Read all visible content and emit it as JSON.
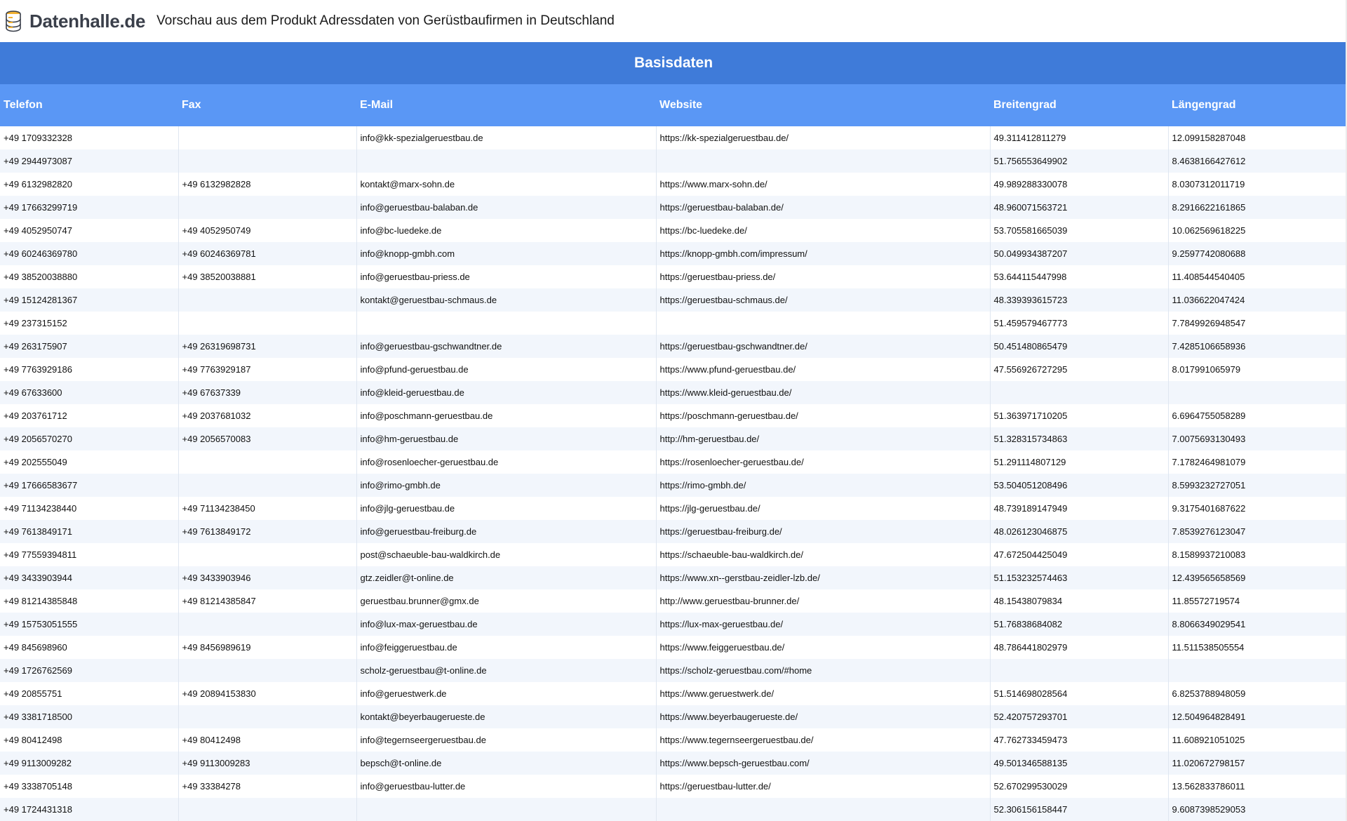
{
  "header": {
    "logo_text": "Datenhalle.de",
    "title": "Vorschau aus dem Produkt Adressdaten von Gerüstbaufirmen in Deutschland"
  },
  "colors": {
    "group_header": "#3f7bd9",
    "column_header": "#5a97f5",
    "row_alt": "#f2f6fc"
  },
  "table": {
    "group_label": "Basisdaten",
    "columns": [
      "Telefon",
      "Fax",
      "E-Mail",
      "Website",
      "Breitengrad",
      "Längengrad"
    ],
    "rows": [
      [
        "+49 1709332328",
        "",
        "info@kk-spezialgeruestbau.de",
        "https://kk-spezialgeruestbau.de/",
        "49.311412811279",
        "12.099158287048"
      ],
      [
        "+49 2944973087",
        "",
        "",
        "",
        "51.756553649902",
        "8.4638166427612"
      ],
      [
        "+49 6132982820",
        "+49 6132982828",
        "kontakt@marx-sohn.de",
        "https://www.marx-sohn.de/",
        "49.989288330078",
        "8.0307312011719"
      ],
      [
        "+49 17663299719",
        "",
        "info@geruestbau-balaban.de",
        "https://geruestbau-balaban.de/",
        "48.960071563721",
        "8.2916622161865"
      ],
      [
        "+49 4052950747",
        "+49 4052950749",
        "info@bc-luedeke.de",
        "https://bc-luedeke.de/",
        "53.705581665039",
        "10.062569618225"
      ],
      [
        "+49 60246369780",
        "+49 60246369781",
        "info@knopp-gmbh.com",
        "https://knopp-gmbh.com/impressum/",
        "50.049934387207",
        "9.2597742080688"
      ],
      [
        "+49 38520038880",
        "+49 38520038881",
        "info@geruestbau-priess.de",
        "https://geruestbau-priess.de/",
        "53.644115447998",
        "11.408544540405"
      ],
      [
        "+49 15124281367",
        "",
        "kontakt@geruestbau-schmaus.de",
        "https://geruestbau-schmaus.de/",
        "48.339393615723",
        "11.036622047424"
      ],
      [
        "+49 237315152",
        "",
        "",
        "",
        "51.459579467773",
        "7.7849926948547"
      ],
      [
        "+49 263175907",
        "+49 26319698731",
        "info@geruestbau-gschwandtner.de",
        "https://geruestbau-gschwandtner.de/",
        "50.451480865479",
        "7.4285106658936"
      ],
      [
        "+49 7763929186",
        "+49 7763929187",
        "info@pfund-geruestbau.de",
        "https://www.pfund-geruestbau.de/",
        "47.556926727295",
        "8.017991065979"
      ],
      [
        "+49 67633600",
        "+49 67637339",
        "info@kleid-geruestbau.de",
        "https://www.kleid-geruestbau.de/",
        "",
        ""
      ],
      [
        "+49 203761712",
        "+49 2037681032",
        "info@poschmann-geruestbau.de",
        "https://poschmann-geruestbau.de/",
        "51.363971710205",
        "6.6964755058289"
      ],
      [
        "+49 2056570270",
        "+49 2056570083",
        "info@hm-geruestbau.de",
        "http://hm-geruestbau.de/",
        "51.328315734863",
        "7.0075693130493"
      ],
      [
        "+49 202555049",
        "",
        "info@rosenloecher-geruestbau.de",
        "https://rosenloecher-geruestbau.de/",
        "51.291114807129",
        "7.1782464981079"
      ],
      [
        "+49 17666583677",
        "",
        "info@rimo-gmbh.de",
        "https://rimo-gmbh.de/",
        "53.504051208496",
        "8.5993232727051"
      ],
      [
        "+49 71134238440",
        "+49 71134238450",
        "info@jlg-geruestbau.de",
        "https://jlg-geruestbau.de/",
        "48.739189147949",
        "9.3175401687622"
      ],
      [
        "+49 7613849171",
        "+49 7613849172",
        "info@geruestbau-freiburg.de",
        "https://geruestbau-freiburg.de/",
        "48.026123046875",
        "7.8539276123047"
      ],
      [
        "+49 77559394811",
        "",
        "post@schaeuble-bau-waldkirch.de",
        "https://schaeuble-bau-waldkirch.de/",
        "47.672504425049",
        "8.1589937210083"
      ],
      [
        "+49 3433903944",
        "+49 3433903946",
        "gtz.zeidler@t-online.de",
        "https://www.xn--gerstbau-zeidler-lzb.de/",
        "51.153232574463",
        "12.439565658569"
      ],
      [
        "+49 81214385848",
        "+49 81214385847",
        "geruestbau.brunner@gmx.de",
        "http://www.geruestbau-brunner.de/",
        "48.15438079834",
        "11.85572719574"
      ],
      [
        "+49 15753051555",
        "",
        "info@lux-max-geruestbau.de",
        "https://lux-max-geruestbau.de/",
        "51.76838684082",
        "8.8066349029541"
      ],
      [
        "+49 845698960",
        "+49 8456989619",
        "info@feiggeruestbau.de",
        "https://www.feiggeruestbau.de/",
        "48.786441802979",
        "11.511538505554"
      ],
      [
        "+49 1726762569",
        "",
        "scholz-geruestbau@t-online.de",
        "https://scholz-geruestbau.com/#home",
        "",
        ""
      ],
      [
        "+49 20855751",
        "+49 20894153830",
        "info@geruestwerk.de",
        "https://www.geruestwerk.de/",
        "51.514698028564",
        "6.8253788948059"
      ],
      [
        "+49 3381718500",
        "",
        "kontakt@beyerbaugerueste.de",
        "https://www.beyerbaugerueste.de/",
        "52.420757293701",
        "12.504964828491"
      ],
      [
        "+49 80412498",
        "+49 80412498",
        "info@tegernseergeruestbau.de",
        "https://www.tegernseergeruestbau.de/",
        "47.762733459473",
        "11.608921051025"
      ],
      [
        "+49 9113009282",
        "+49 9113009283",
        "bepsch@t-online.de",
        "https://www.bepsch-geruestbau.com/",
        "49.501346588135",
        "11.020672798157"
      ],
      [
        "+49 3338705148",
        "+49 33384278",
        "info@geruestbau-lutter.de",
        "https://geruestbau-lutter.de/",
        "52.670299530029",
        "13.562833786011"
      ],
      [
        "+49 1724431318",
        "",
        "",
        "",
        "52.306156158447",
        "9.6087398529053"
      ]
    ]
  }
}
